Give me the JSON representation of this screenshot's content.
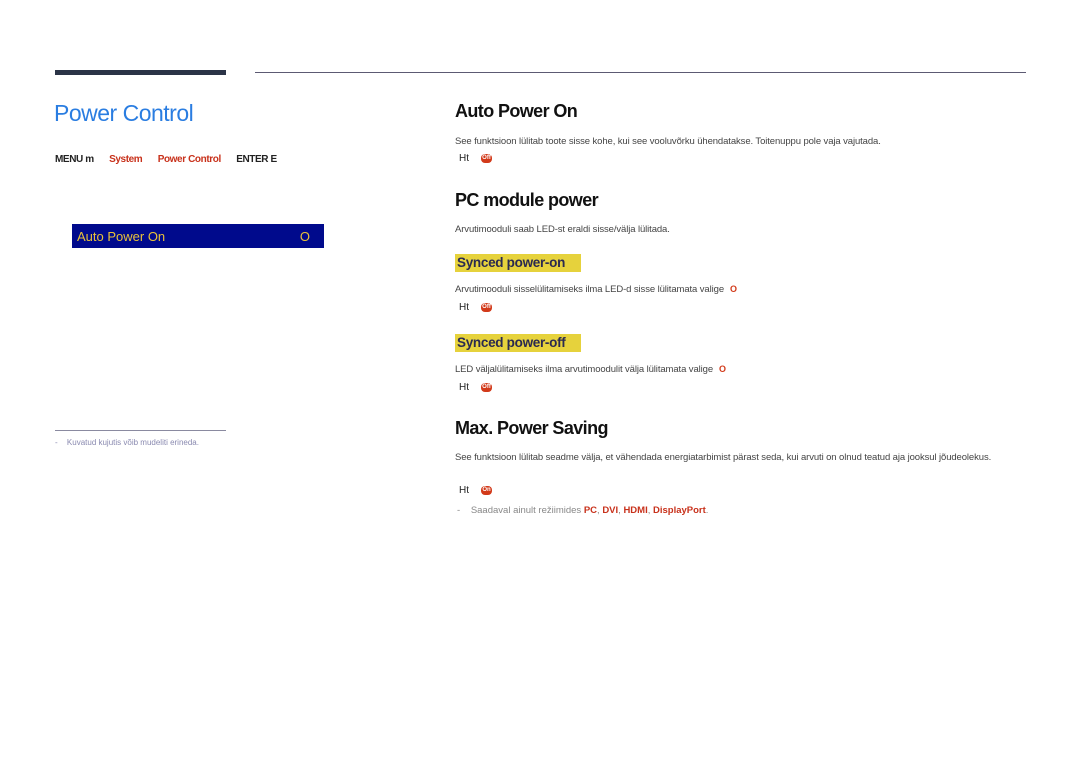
{
  "left": {
    "title": "Power Control",
    "menu_path": [
      {
        "label": "MENU m",
        "highlight": false
      },
      {
        "label": "System",
        "highlight": true
      },
      {
        "label": "Power Control",
        "highlight": true
      },
      {
        "label": "ENTER E",
        "highlight": false
      }
    ],
    "osd": {
      "label": "Auto Power On",
      "value": "O"
    },
    "footnote": {
      "dash": "-",
      "text": "Kuvatud kujutis võib mudeliti erineda."
    }
  },
  "sections": {
    "auto_power_on": {
      "heading": "Auto Power On",
      "description": "See funktsioon lülitab toote sisse kohe, kui see vooluvõrku ühendatakse. Toitenuppu pole vaja vajutada.",
      "options_label": "Ht",
      "options_badge": "Off"
    },
    "pc_module_power": {
      "heading": "PC module power",
      "description": "Arvutimooduli saab LED-st eraldi sisse/välja lülitada.",
      "synced_on": {
        "heading": "Synced power-on",
        "description": "Arvutimooduli sisselülitamiseks ilma LED-d sisse lülitamata valige",
        "inline_badge": "O",
        "options_label": "Ht",
        "options_badge": "Off"
      },
      "synced_off": {
        "heading": "Synced power-off",
        "description": "LED väljalülitamiseks ilma arvutimoodulit välja lülitamata valige",
        "inline_badge": "O",
        "options_label": "Ht",
        "options_badge": "Off"
      }
    },
    "max_power_saving": {
      "heading": "Max. Power Saving",
      "description": "See funktsioon lülitab seadme välja, et vähendada energiatarbimist pärast seda, kui arvuti on olnud teatud aja jooksul jõudeolekus.",
      "options_label": "Ht",
      "options_badge": "On",
      "note": {
        "dash": "-",
        "prefix": "Saadaval ainult režiimides",
        "modes": [
          "PC",
          "DVI",
          "HDMI",
          "DisplayPort"
        ],
        "suffix": "."
      }
    }
  },
  "colors": {
    "accent_blue": "#2a7de1",
    "accent_red": "#c8311b",
    "osd_bg": "#000a8c",
    "osd_text": "#e8c23a",
    "highlight": "#e6d23c"
  }
}
